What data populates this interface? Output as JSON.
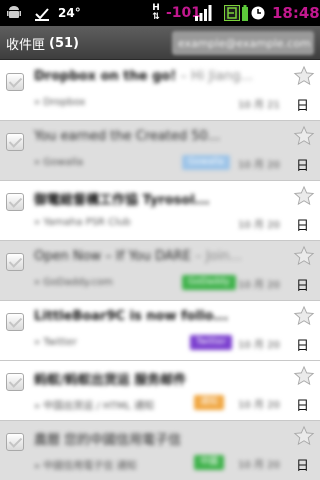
{
  "status_bar": {
    "temperature": "24°",
    "signal_value": "-101",
    "clock": "18:48",
    "icons": [
      "android-icon",
      "usb-icon",
      "h-data-icon",
      "signal-bars-icon",
      "e-notification-icon",
      "battery-icon",
      "alarm-icon"
    ]
  },
  "title_bar": {
    "label": "收件匣",
    "count": "(51)",
    "account": "example@example.com"
  },
  "colors": {
    "accent": "#c2188f",
    "label_blue": "#9dc4e8",
    "label_green": "#3fb24b",
    "label_purple": "#7b3fcf",
    "label_orange": "#f0a640"
  },
  "messages": [
    {
      "subject": "Dropbox on the go!",
      "snippet": " – Hi Jiang...",
      "sender": "» Dropbox",
      "date": "10 月 21",
      "day": "日",
      "read": false,
      "label": "",
      "label_color": ""
    },
    {
      "subject": "You earned the Created 50...",
      "snippet": "",
      "sender": "» Gowalla",
      "date": "10 月 20",
      "day": "日",
      "read": true,
      "label": "Gowalla",
      "label_color": "#9dc4e8"
    },
    {
      "subject": "御電総督構工作協 Tyrosol...",
      "snippet": "",
      "sender": "» Yamaha PSR Club",
      "date": "10 月 20",
      "day": "日",
      "read": false,
      "label": "",
      "label_color": ""
    },
    {
      "subject": "Open Now – If You DARE",
      "snippet": " – Join...",
      "sender": "» GoDaddy.com",
      "date": "10 月 20",
      "day": "日",
      "read": true,
      "label": "GoDaddy",
      "label_color": "#3fb24b"
    },
    {
      "subject": "LittleBoar9C is now follo...",
      "snippet": "",
      "sender": "» Twitter",
      "date": "10 月 20",
      "day": "日",
      "read": false,
      "label": "Twitter",
      "label_color": "#7b3fcf"
    },
    {
      "subject": "蚂蚁/蚂蚁出货运 服务邮件",
      "snippet": "",
      "sender": "» 中国出货运 / HTML 通知",
      "date": "10 月 20",
      "day": "日",
      "read": false,
      "label": "通知",
      "label_color": "#f0a640"
    },
    {
      "subject": "農曆 您的中國信用電子信",
      "snippet": "",
      "sender": "» 中國信用電子信 通知",
      "date": "10 月 20",
      "day": "日",
      "read": true,
      "label": "中國",
      "label_color": "#3fb24b"
    }
  ]
}
